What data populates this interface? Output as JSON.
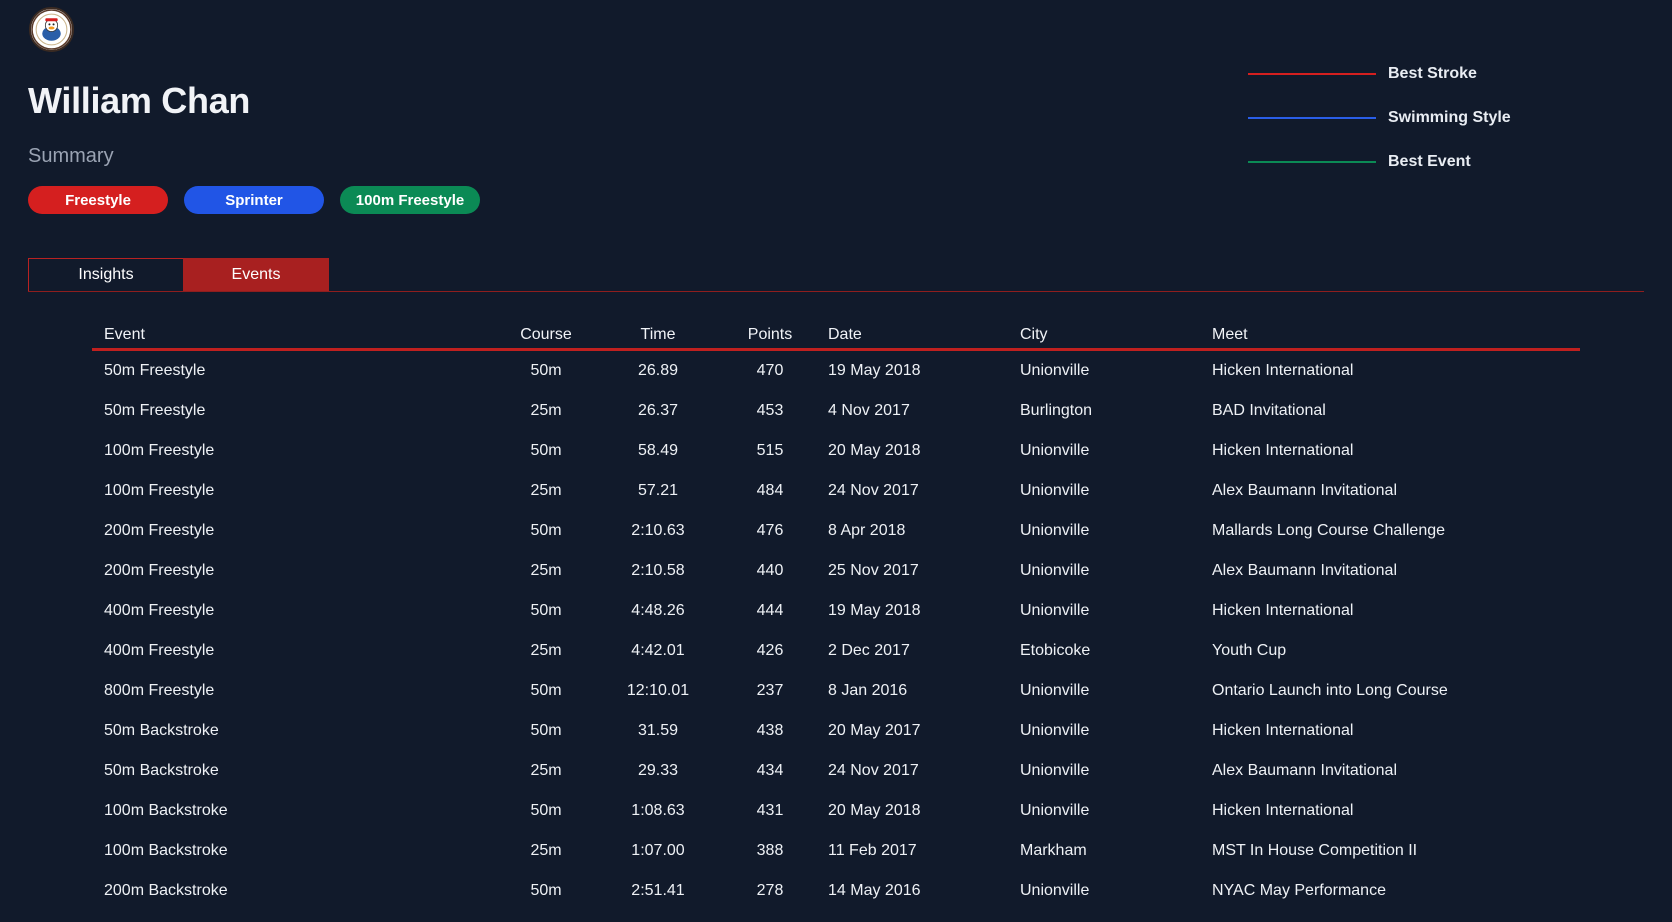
{
  "swimmer": {
    "name": "William Chan"
  },
  "summary": {
    "heading": "Summary",
    "badges": [
      {
        "label": "Freestyle",
        "color": "#d51f1f"
      },
      {
        "label": "Sprinter",
        "color": "#2155e6"
      },
      {
        "label": "100m Freestyle",
        "color": "#0b8a55"
      }
    ]
  },
  "legend": [
    {
      "label": "Best Stroke",
      "color": "#d51f1f"
    },
    {
      "label": "Swimming Style",
      "color": "#2a5ee8"
    },
    {
      "label": "Best Event",
      "color": "#0b8a55"
    }
  ],
  "tabs": [
    {
      "label": "Insights",
      "active": false
    },
    {
      "label": "Events",
      "active": true
    }
  ],
  "table": {
    "headers": [
      "Event",
      "Course",
      "Time",
      "Points",
      "Date",
      "City",
      "Meet"
    ],
    "rows": [
      [
        "50m Freestyle",
        "50m",
        "26.89",
        "470",
        "19 May 2018",
        "Unionville",
        "Hicken International"
      ],
      [
        "50m Freestyle",
        "25m",
        "26.37",
        "453",
        "4 Nov 2017",
        "Burlington",
        "BAD Invitational"
      ],
      [
        "100m Freestyle",
        "50m",
        "58.49",
        "515",
        "20 May 2018",
        "Unionville",
        "Hicken International"
      ],
      [
        "100m Freestyle",
        "25m",
        "57.21",
        "484",
        "24 Nov 2017",
        "Unionville",
        "Alex Baumann Invitational"
      ],
      [
        "200m Freestyle",
        "50m",
        "2:10.63",
        "476",
        "8 Apr 2018",
        "Unionville",
        "Mallards Long Course Challenge"
      ],
      [
        "200m Freestyle",
        "25m",
        "2:10.58",
        "440",
        "25 Nov 2017",
        "Unionville",
        "Alex Baumann Invitational"
      ],
      [
        "400m Freestyle",
        "50m",
        "4:48.26",
        "444",
        "19 May 2018",
        "Unionville",
        "Hicken International"
      ],
      [
        "400m Freestyle",
        "25m",
        "4:42.01",
        "426",
        "2 Dec 2017",
        "Etobicoke",
        "Youth Cup"
      ],
      [
        "800m Freestyle",
        "50m",
        "12:10.01",
        "237",
        "8 Jan 2016",
        "Unionville",
        "Ontario Launch into Long Course"
      ],
      [
        "50m Backstroke",
        "50m",
        "31.59",
        "438",
        "20 May 2017",
        "Unionville",
        "Hicken International"
      ],
      [
        "50m Backstroke",
        "25m",
        "29.33",
        "434",
        "24 Nov 2017",
        "Unionville",
        "Alex Baumann Invitational"
      ],
      [
        "100m Backstroke",
        "50m",
        "1:08.63",
        "431",
        "20 May 2018",
        "Unionville",
        "Hicken International"
      ],
      [
        "100m Backstroke",
        "25m",
        "1:07.00",
        "388",
        "11 Feb 2017",
        "Markham",
        "MST In House Competition II"
      ],
      [
        "200m Backstroke",
        "50m",
        "2:51.41",
        "278",
        "14 May 2016",
        "Unionville",
        "NYAC May Performance"
      ]
    ]
  }
}
